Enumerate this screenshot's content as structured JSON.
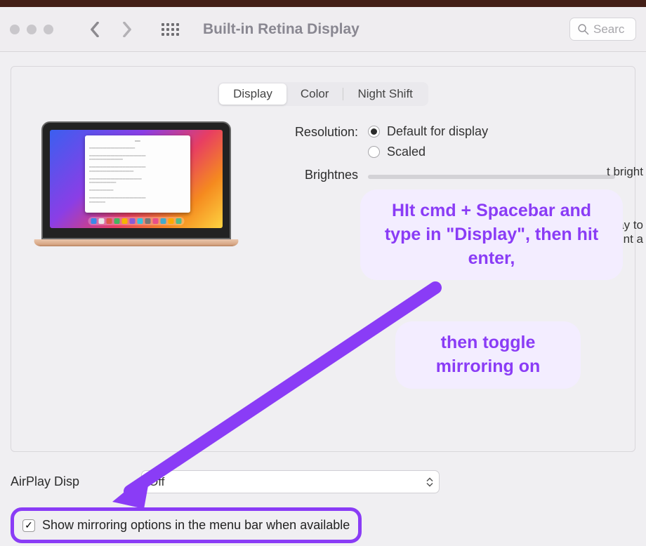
{
  "toolbar": {
    "title": "Built-in Retina Display",
    "search_placeholder": "Searc"
  },
  "tabs": {
    "display": "Display",
    "color": "Color",
    "night_shift": "Night Shift"
  },
  "settings": {
    "resolution_label": "Resolution:",
    "resolution_default": "Default for display",
    "resolution_scaled": "Scaled",
    "brightness_label": "Brightnes",
    "auto_bright_fragment": "t bright",
    "airplay_fragment1": "ay to",
    "airplay_fragment2": "fferent a"
  },
  "airplay": {
    "label": "AirPlay Disp",
    "value": "Off"
  },
  "mirror": {
    "label": "Show mirroring options in the menu bar when available"
  },
  "annotation": {
    "line1": "HIt cmd + Spacebar and type in \"Display\", then hit enter,",
    "line2": "then toggle mirroring on"
  }
}
